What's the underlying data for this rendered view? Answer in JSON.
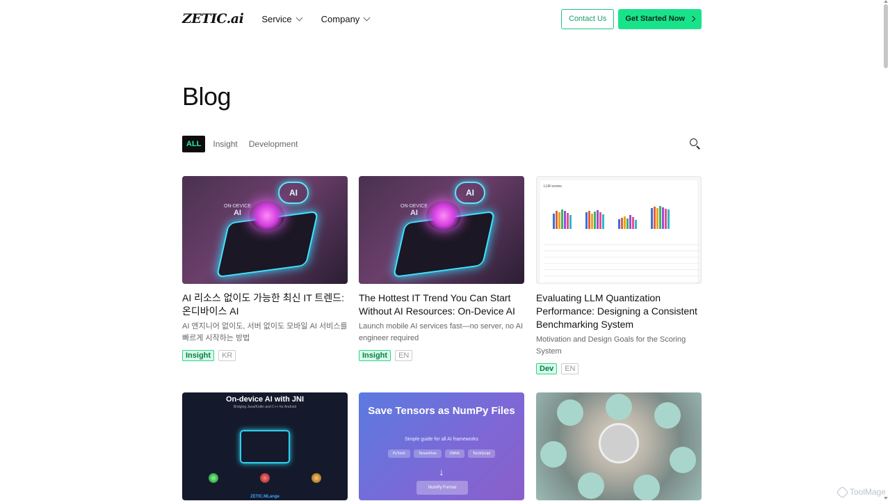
{
  "header": {
    "logo": "ZETIC.ai",
    "nav": [
      "Service",
      "Company"
    ],
    "contact_label": "Contact Us",
    "cta_label": "Get Started Now"
  },
  "page_title": "Blog",
  "filters": {
    "active": "ALL",
    "items": [
      "Insight",
      "Development"
    ]
  },
  "cards": [
    {
      "title": "AI 리소스 없이도 가능한 최신 IT 트렌드: 온디바이스 AI",
      "desc": "AI 엔지니어 없이도, 서버 없이도 모바일 AI 서비스를 빠르게 시작하는 방법",
      "tag": "Insight",
      "lang": "KR"
    },
    {
      "title": "The Hottest IT Trend You Can Start Without AI Resources: On-Device AI",
      "desc": "Launch mobile AI services fast—no server, no AI engineer required",
      "tag": "Insight",
      "lang": "EN"
    },
    {
      "title": "Evaluating LLM Quantization Performance: Designing a Consistent Benchmarking System",
      "desc": "Motivation and Design Goals for the Scoring System",
      "tag": "Dev",
      "lang": "EN"
    }
  ],
  "thumbs": {
    "brain": {
      "ai_badge": "AI",
      "ondevice_small": "ON-DEVICE",
      "ondevice_big": "AI"
    },
    "chart": {
      "label": "LLM scores"
    },
    "jni": {
      "title": "On-device AI with JNI",
      "subtitle": "Bridging Java/Kotlin and C++ for Android",
      "footer": "ZETIC.MLange"
    },
    "tensor": {
      "title": "Save Tensors as NumPy Files",
      "subtitle": "Simple guide for all AI frameworks",
      "pills": [
        "PyTorch",
        "TensorFlow",
        "ONNX",
        "TorchScript"
      ],
      "arrow": "↓",
      "format": "NumPy Format"
    }
  },
  "watermark": "ToolMage"
}
